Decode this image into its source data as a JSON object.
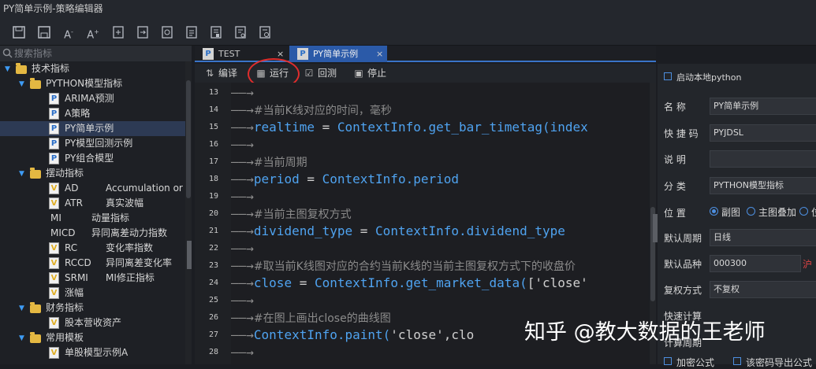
{
  "window": {
    "title": "PY简单示例-策略编辑器"
  },
  "toolbar": {
    "icons": [
      "save-icon",
      "save-as-icon",
      "font-decrease-icon",
      "font-increase-icon",
      "import-icon",
      "export-icon",
      "refresh-icon",
      "document-icon",
      "document2-icon",
      "document3-icon",
      "document4-icon"
    ],
    "font_minus": "A",
    "font_plus": "A"
  },
  "sidebar": {
    "search_placeholder": "搜索指标",
    "tree": [
      {
        "label": "技术指标",
        "type": "folder",
        "level": 0
      },
      {
        "label": "PYTHON模型指标",
        "type": "folder",
        "level": 1
      },
      {
        "label": "ARIMA预测",
        "type": "file",
        "icon": "P",
        "level": 2
      },
      {
        "label": "A策略",
        "type": "file",
        "icon": "P",
        "level": 2
      },
      {
        "label": "PY简单示例",
        "type": "file",
        "icon": "P",
        "level": 2,
        "selected": true
      },
      {
        "label": "PY模型回测示例",
        "type": "file",
        "icon": "P",
        "level": 2
      },
      {
        "label": "PY组合模型",
        "type": "file",
        "icon": "P",
        "level": 2
      },
      {
        "label": "摆动指标",
        "type": "folder",
        "level": 1
      },
      {
        "label": "AD",
        "desc": "Accumulation or",
        "type": "file",
        "icon": "V",
        "level": 2
      },
      {
        "label": "ATR",
        "desc": "真实波幅",
        "type": "file",
        "icon": "V",
        "level": 2
      },
      {
        "label": "MI",
        "desc": "动量指标",
        "type": "plain",
        "level": 2
      },
      {
        "label": "MICD",
        "desc": "异同离差动力指数",
        "type": "plain",
        "level": 2
      },
      {
        "label": "RC",
        "desc": "变化率指数",
        "type": "file",
        "icon": "V",
        "level": 2
      },
      {
        "label": "RCCD",
        "desc": "异同离差变化率",
        "type": "file",
        "icon": "V",
        "level": 2
      },
      {
        "label": "SRMI",
        "desc": "MI修正指标",
        "type": "file",
        "icon": "V",
        "level": 2
      },
      {
        "label": "涨幅",
        "type": "file",
        "icon": "V",
        "level": 2
      },
      {
        "label": "财务指标",
        "type": "folder",
        "level": 1
      },
      {
        "label": "股本营收资产",
        "type": "file",
        "icon": "V",
        "level": 2
      },
      {
        "label": "常用模板",
        "type": "folder",
        "level": 1
      },
      {
        "label": "单股模型示例A",
        "type": "file",
        "icon": "V",
        "level": 2
      }
    ]
  },
  "tabs": [
    {
      "label": "TEST",
      "icon": "P",
      "close": "×",
      "active": false
    },
    {
      "label": "PY简单示例",
      "icon": "P",
      "close": "×",
      "active": true
    }
  ],
  "editor_toolbar": {
    "compile": "编译",
    "run": "运行",
    "backtest": "回测",
    "stop": "停止"
  },
  "editor": {
    "lines": [
      {
        "n": "13",
        "segs": []
      },
      {
        "n": "14",
        "segs": [
          {
            "c": "cmt",
            "t": "#当前K线对应的时间，毫秒"
          }
        ]
      },
      {
        "n": "15",
        "segs": [
          {
            "c": "id",
            "t": "realtime"
          },
          {
            "c": "op",
            "t": " = "
          },
          {
            "c": "id",
            "t": "ContextInfo.get_bar_timetag(index"
          }
        ]
      },
      {
        "n": "16",
        "segs": []
      },
      {
        "n": "17",
        "segs": [
          {
            "c": "cmt",
            "t": "#当前周期"
          }
        ]
      },
      {
        "n": "18",
        "segs": [
          {
            "c": "id",
            "t": "period"
          },
          {
            "c": "op",
            "t": " = "
          },
          {
            "c": "id",
            "t": "ContextInfo.period"
          }
        ]
      },
      {
        "n": "19",
        "segs": []
      },
      {
        "n": "20",
        "segs": [
          {
            "c": "cmt",
            "t": "#当前主图复权方式"
          }
        ]
      },
      {
        "n": "21",
        "segs": [
          {
            "c": "id",
            "t": "dividend_type"
          },
          {
            "c": "op",
            "t": " = "
          },
          {
            "c": "id",
            "t": "ContextInfo.dividend_type"
          }
        ]
      },
      {
        "n": "22",
        "segs": []
      },
      {
        "n": "23",
        "segs": [
          {
            "c": "cmt",
            "t": "#取当前K线图对应的合约当前K线的当前主图复权方式下的收盘价"
          }
        ]
      },
      {
        "n": "24",
        "segs": [
          {
            "c": "id",
            "t": "close"
          },
          {
            "c": "op",
            "t": " = "
          },
          {
            "c": "id",
            "t": "ContextInfo.get_market_data("
          },
          {
            "c": "str",
            "t": "['close'"
          }
        ]
      },
      {
        "n": "25",
        "segs": []
      },
      {
        "n": "26",
        "segs": [
          {
            "c": "cmt",
            "t": "#在图上画出close的曲线图"
          }
        ]
      },
      {
        "n": "27",
        "segs": [
          {
            "c": "id",
            "t": "ContextInfo.paint("
          },
          {
            "c": "str",
            "t": "'close'"
          },
          {
            "c": "op",
            "t": ",clo"
          }
        ]
      },
      {
        "n": "28",
        "segs": []
      }
    ],
    "arrow_glyph": "——→"
  },
  "properties": {
    "local_python": "启动本地python",
    "name_label": "名 称",
    "name_value": "PY简单示例",
    "shortcut_label": "快 捷 码",
    "shortcut_value": "PYJDSL",
    "desc_label": "说 明",
    "desc_value": "",
    "category_label": "分 类",
    "category_value": "PYTHON模型指标",
    "position_label": "位 置",
    "position_opt1": "副图",
    "position_opt2": "主图叠加",
    "position_opt3": "位",
    "period_label": "默认周期",
    "period_value": "日线",
    "symbol_label": "默认品种",
    "symbol_value": "000300",
    "symbol_suffix": "沪",
    "adjust_label": "复权方式",
    "adjust_value": "不复权",
    "calc_label": "快速计算",
    "calc_label2": "计算周期",
    "encrypt": "加密公式",
    "import_formula": "该密码导出公式"
  },
  "watermark": "知乎 @教大数据的王老师",
  "colors": {
    "accent": "#2b5aa8",
    "folder": "#e4b842",
    "annotation": "#e02d2d",
    "identifier": "#4fa3f0"
  }
}
